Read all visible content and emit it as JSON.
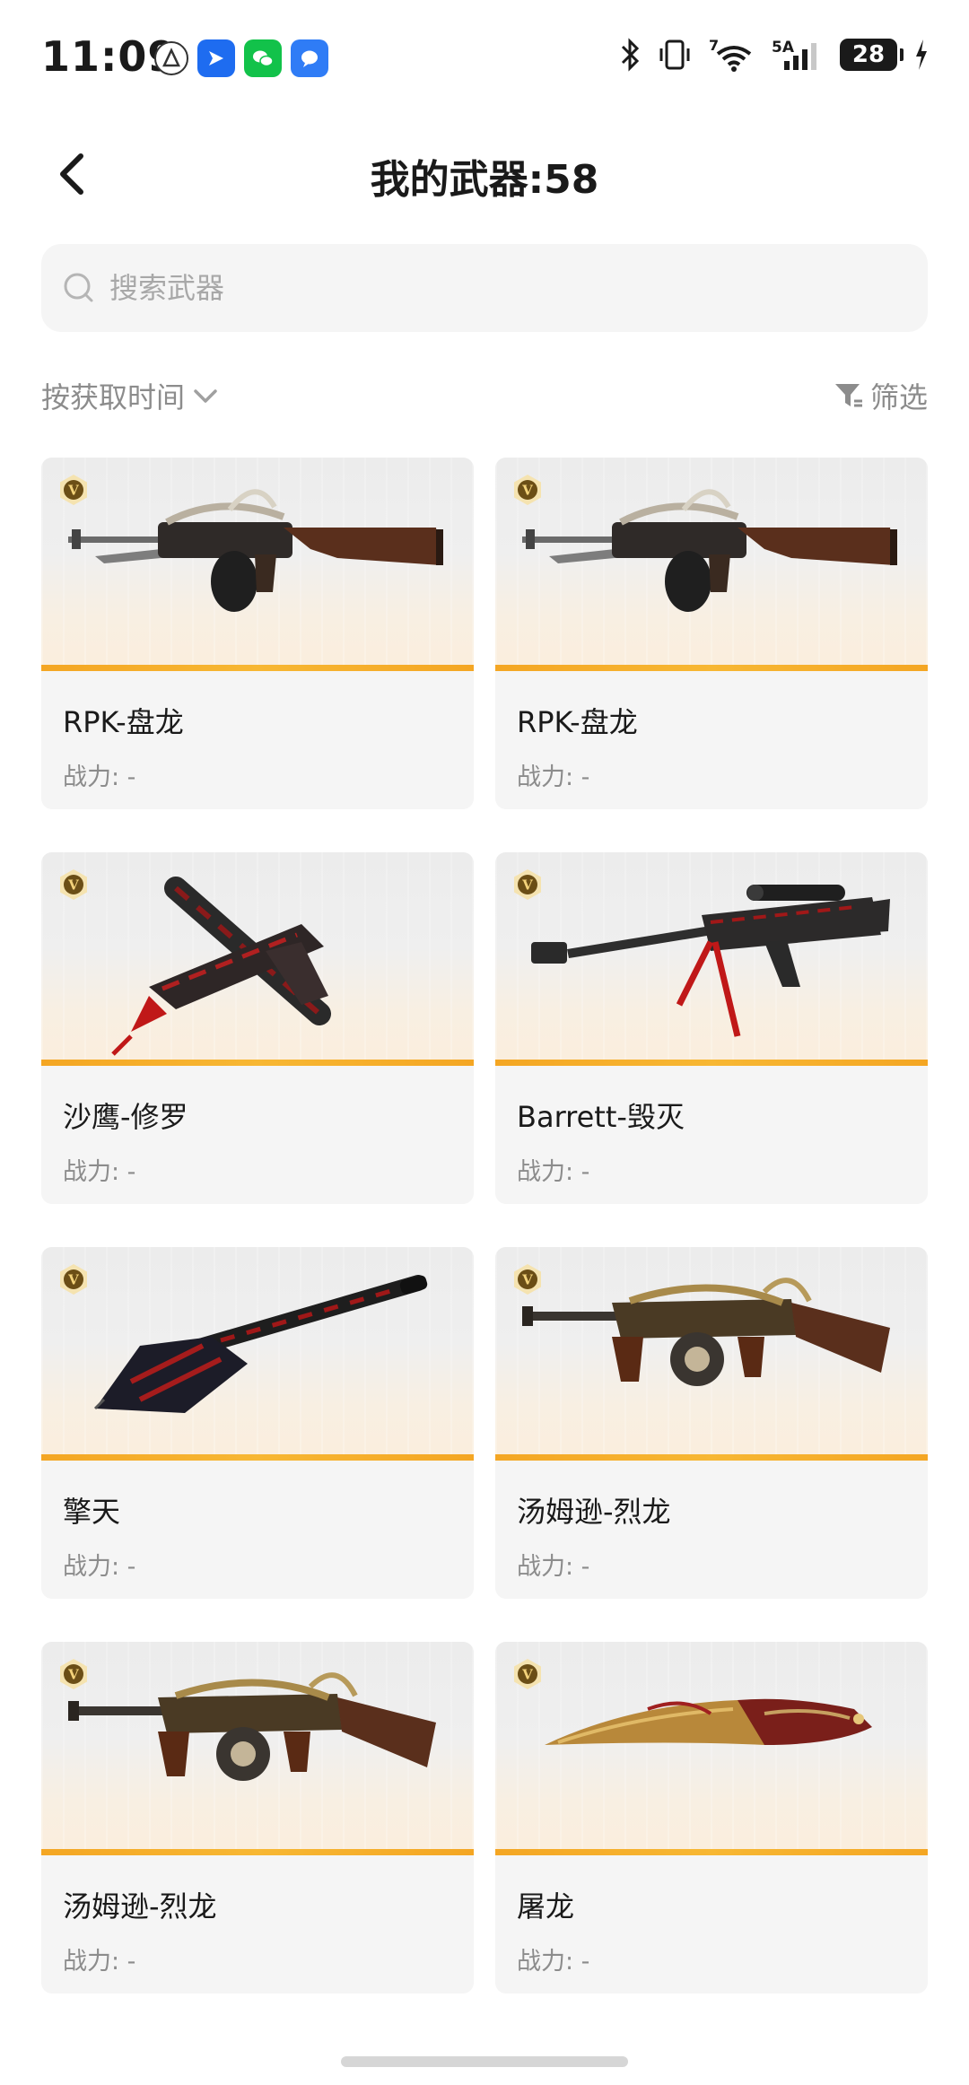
{
  "status_bar": {
    "time": "11:09",
    "network_label": "5A",
    "wifi_label": "7",
    "battery": "28"
  },
  "header": {
    "title": "我的武器:58"
  },
  "search": {
    "placeholder": "搜索武器"
  },
  "toolbar": {
    "sort_label": "按获取时间",
    "filter_label": "筛选"
  },
  "weapons": [
    {
      "name": "RPK-盘龙",
      "power": "战力: -",
      "icon": "rpk-machine-gun"
    },
    {
      "name": "RPK-盘龙",
      "power": "战力: -",
      "icon": "rpk-machine-gun"
    },
    {
      "name": "沙鹰-修罗",
      "power": "战力: -",
      "icon": "desert-eagle-pistol"
    },
    {
      "name": "Barrett-毁灭",
      "power": "战力: -",
      "icon": "barrett-sniper-rifle"
    },
    {
      "name": "擎天",
      "power": "战力: -",
      "icon": "shovel-melee"
    },
    {
      "name": "汤姆逊-烈龙",
      "power": "战力: -",
      "icon": "thompson-smg"
    },
    {
      "name": "汤姆逊-烈龙",
      "power": "战力: -",
      "icon": "thompson-smg"
    },
    {
      "name": "屠龙",
      "power": "战力: -",
      "icon": "dragon-blade"
    }
  ],
  "colors": {
    "accent": "#f4a623",
    "text_secondary": "#8c8c8c",
    "card_bg": "#f5f5f5"
  }
}
